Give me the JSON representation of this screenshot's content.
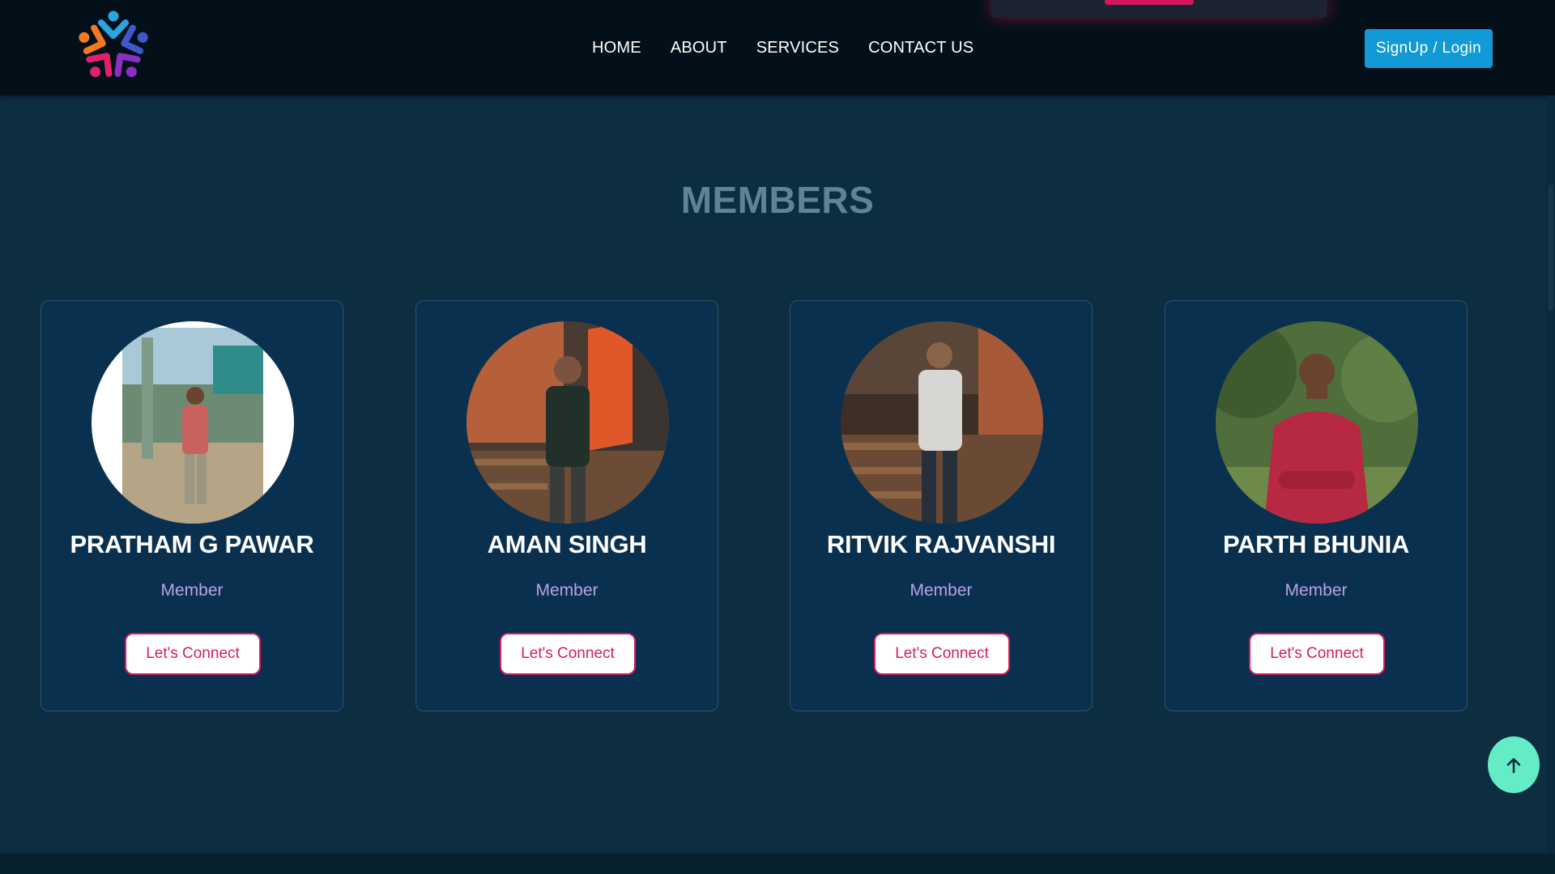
{
  "nav": {
    "links": [
      "HOME",
      "ABOUT",
      "SERVICES",
      "CONTACT US"
    ],
    "signup_label": "SignUp / Login"
  },
  "icons": {
    "logo": "star-people-logo-icon",
    "scroll_top": "arrow-up-icon"
  },
  "colors": {
    "page_bg": "#0d2d40",
    "navbar_bg": "#041019",
    "card_bg": "#0a304f",
    "accent_blue": "#119ad6",
    "accent_pink": "#d81b60",
    "role_text": "#b9a2e6",
    "title_text": "#5d8597",
    "scroll_top_bg": "#63ecc6"
  },
  "members_section": {
    "title": "MEMBERS",
    "members": [
      {
        "name": "PRATHAM G PAWAR",
        "role": "Member",
        "button": "Let's Connect"
      },
      {
        "name": "AMAN SINGH",
        "role": "Member",
        "button": "Let's Connect"
      },
      {
        "name": "RITVIK RAJVANSHI",
        "role": "Member",
        "button": "Let's Connect"
      },
      {
        "name": "PARTH BHUNIA",
        "role": "Member",
        "button": "Let's Connect"
      }
    ]
  }
}
